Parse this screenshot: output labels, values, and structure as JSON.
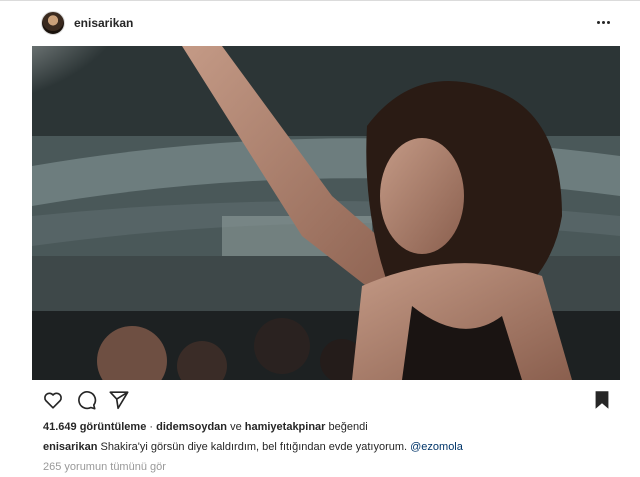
{
  "post": {
    "username": "enisarikan",
    "avatar_icon": "profile-avatar",
    "more_icon": "more-options-icon",
    "media_description_colors": {
      "stadium": "#5f6e70",
      "lights": "#e9f0ef"
    }
  },
  "actions": {
    "like_icon": "heart-icon",
    "comment_icon": "comment-bubble-icon",
    "share_icon": "paper-plane-icon",
    "save_icon": "bookmark-icon"
  },
  "stats": {
    "views_count": "41.649 görüntüleme",
    "separator": " · ",
    "liker_1": "didemsoydan",
    "and_word": " ve ",
    "liker_2": "hamiyetakpinar",
    "liked_word": " beğendi"
  },
  "caption": {
    "author": "enisarikan",
    "text": " Shakira'yi görsün diye kaldırdım, bel fıtığından evde yatıyorum. ",
    "mention": "@ezomola"
  },
  "comments": {
    "view_all": "265 yorumun tümünü gör"
  }
}
